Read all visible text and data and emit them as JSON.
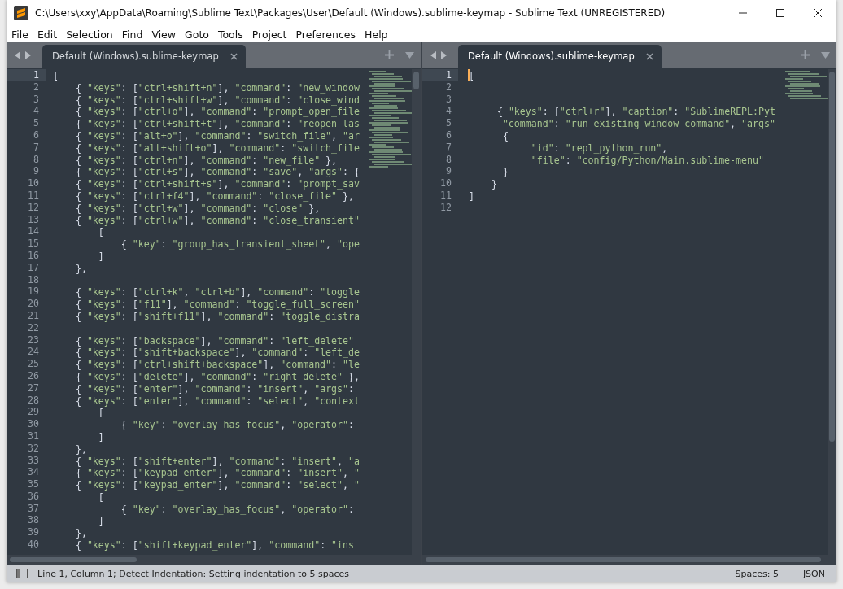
{
  "window": {
    "title": "C:\\Users\\xxy\\AppData\\Roaming\\Sublime Text\\Packages\\User\\Default (Windows).sublime-keymap - Sublime Text (UNREGISTERED)"
  },
  "menu": [
    {
      "label": "File"
    },
    {
      "label": "Edit"
    },
    {
      "label": "Selection"
    },
    {
      "label": "Find"
    },
    {
      "label": "View"
    },
    {
      "label": "Goto"
    },
    {
      "label": "Tools"
    },
    {
      "label": "Project"
    },
    {
      "label": "Preferences"
    },
    {
      "label": "Help"
    }
  ],
  "panes": [
    {
      "tab": {
        "label": "Default (Windows).sublime-keymap",
        "selected": true
      },
      "focused": false,
      "lines": [
        {
          "number": "1",
          "code": "[",
          "current": true
        },
        {
          "number": "2",
          "code": "    { \"keys\": [\"ctrl+shift+n\"], \"command\": \"new_window",
          "current": false
        },
        {
          "number": "3",
          "code": "    { \"keys\": [\"ctrl+shift+w\"], \"command\": \"close_wind",
          "current": false
        },
        {
          "number": "4",
          "code": "    { \"keys\": [\"ctrl+o\"], \"command\": \"prompt_open_file",
          "current": false
        },
        {
          "number": "5",
          "code": "    { \"keys\": [\"ctrl+shift+t\"], \"command\": \"reopen_las",
          "current": false
        },
        {
          "number": "6",
          "code": "    { \"keys\": [\"alt+o\"], \"command\": \"switch_file\", \"ar",
          "current": false
        },
        {
          "number": "7",
          "code": "    { \"keys\": [\"alt+shift+o\"], \"command\": \"switch_file",
          "current": false
        },
        {
          "number": "8",
          "code": "    { \"keys\": [\"ctrl+n\"], \"command\": \"new_file\" },",
          "current": false
        },
        {
          "number": "9",
          "code": "    { \"keys\": [\"ctrl+s\"], \"command\": \"save\", \"args\": {",
          "current": false
        },
        {
          "number": "10",
          "code": "    { \"keys\": [\"ctrl+shift+s\"], \"command\": \"prompt_sav",
          "current": false
        },
        {
          "number": "11",
          "code": "    { \"keys\": [\"ctrl+f4\"], \"command\": \"close_file\" },",
          "current": false
        },
        {
          "number": "12",
          "code": "    { \"keys\": [\"ctrl+w\"], \"command\": \"close\" },",
          "current": false
        },
        {
          "number": "13",
          "code": "    { \"keys\": [\"ctrl+w\"], \"command\": \"close_transient\"",
          "current": false
        },
        {
          "number": "14",
          "code": "        [",
          "current": false
        },
        {
          "number": "15",
          "code": "            { \"key\": \"group_has_transient_sheet\", \"ope",
          "current": false
        },
        {
          "number": "16",
          "code": "        ]",
          "current": false
        },
        {
          "number": "17",
          "code": "    },",
          "current": false
        },
        {
          "number": "18",
          "current": false
        },
        {
          "number": "19",
          "code": "    { \"keys\": [\"ctrl+k\", \"ctrl+b\"], \"command\": \"toggle",
          "current": false
        },
        {
          "number": "20",
          "code": "    { \"keys\": [\"f11\"], \"command\": \"toggle_full_screen\"",
          "current": false
        },
        {
          "number": "21",
          "code": "    { \"keys\": [\"shift+f11\"], \"command\": \"toggle_distra",
          "current": false
        },
        {
          "number": "22",
          "current": false
        },
        {
          "number": "23",
          "code": "    { \"keys\": [\"backspace\"], \"command\": \"left_delete\"",
          "current": false
        },
        {
          "number": "24",
          "code": "    { \"keys\": [\"shift+backspace\"], \"command\": \"left_de",
          "current": false
        },
        {
          "number": "25",
          "code": "    { \"keys\": [\"ctrl+shift+backspace\"], \"command\": \"le",
          "current": false
        },
        {
          "number": "26",
          "code": "    { \"keys\": [\"delete\"], \"command\": \"right_delete\" },",
          "current": false
        },
        {
          "number": "27",
          "code": "    { \"keys\": [\"enter\"], \"command\": \"insert\", \"args\":",
          "current": false
        },
        {
          "number": "28",
          "code": "    { \"keys\": [\"enter\"], \"command\": \"select\", \"context",
          "current": false
        },
        {
          "number": "29",
          "code": "        [",
          "current": false
        },
        {
          "number": "30",
          "code": "            { \"key\": \"overlay_has_focus\", \"operator\":",
          "current": false
        },
        {
          "number": "31",
          "code": "        ]",
          "current": false
        },
        {
          "number": "32",
          "code": "    },",
          "current": false
        },
        {
          "number": "33",
          "code": "    { \"keys\": [\"shift+enter\"], \"command\": \"insert\", \"a",
          "current": false
        },
        {
          "number": "34",
          "code": "    { \"keys\": [\"keypad_enter\"], \"command\": \"insert\", \"",
          "current": false
        },
        {
          "number": "35",
          "code": "    { \"keys\": [\"keypad_enter\"], \"command\": \"select\", \"",
          "current": false
        },
        {
          "number": "36",
          "code": "        [",
          "current": false
        },
        {
          "number": "37",
          "code": "            { \"key\": \"overlay_has_focus\", \"operator\":",
          "current": false
        },
        {
          "number": "38",
          "code": "        ]",
          "current": false
        },
        {
          "number": "39",
          "code": "    },",
          "current": false
        },
        {
          "number": "40",
          "code": "    { \"keys\": [\"shift+keypad_enter\"], \"command\": \"ins",
          "current": false
        }
      ]
    },
    {
      "tab": {
        "label": "Default (Windows).sublime-keymap",
        "selected": true
      },
      "focused": true,
      "lines": [
        {
          "number": "1",
          "code": "[",
          "current": true
        },
        {
          "number": "2",
          "current": false
        },
        {
          "number": "3",
          "current": false
        },
        {
          "number": "4",
          "code": "     { \"keys\": [\"ctrl+r\"], \"caption\": \"SublimeREPL:Pyt",
          "current": false
        },
        {
          "number": "5",
          "code": "      \"command\": \"run_existing_window_command\", \"args\"",
          "current": false
        },
        {
          "number": "6",
          "code": "      {",
          "current": false
        },
        {
          "number": "7",
          "code": "           \"id\": \"repl_python_run\",",
          "current": false
        },
        {
          "number": "8",
          "code": "           \"file\": \"config/Python/Main.sublime-menu\"",
          "current": false
        },
        {
          "number": "9",
          "code": "      }",
          "current": false
        },
        {
          "number": "10",
          "code": "    }",
          "current": false
        },
        {
          "number": "11",
          "code": "]",
          "current": false
        },
        {
          "number": "12",
          "current": false
        }
      ]
    }
  ],
  "status_bar": {
    "message": "Line 1, Column 1; Detect Indentation: Setting indentation to 5 spaces",
    "indentation": "Spaces: 5",
    "syntax": "JSON"
  }
}
